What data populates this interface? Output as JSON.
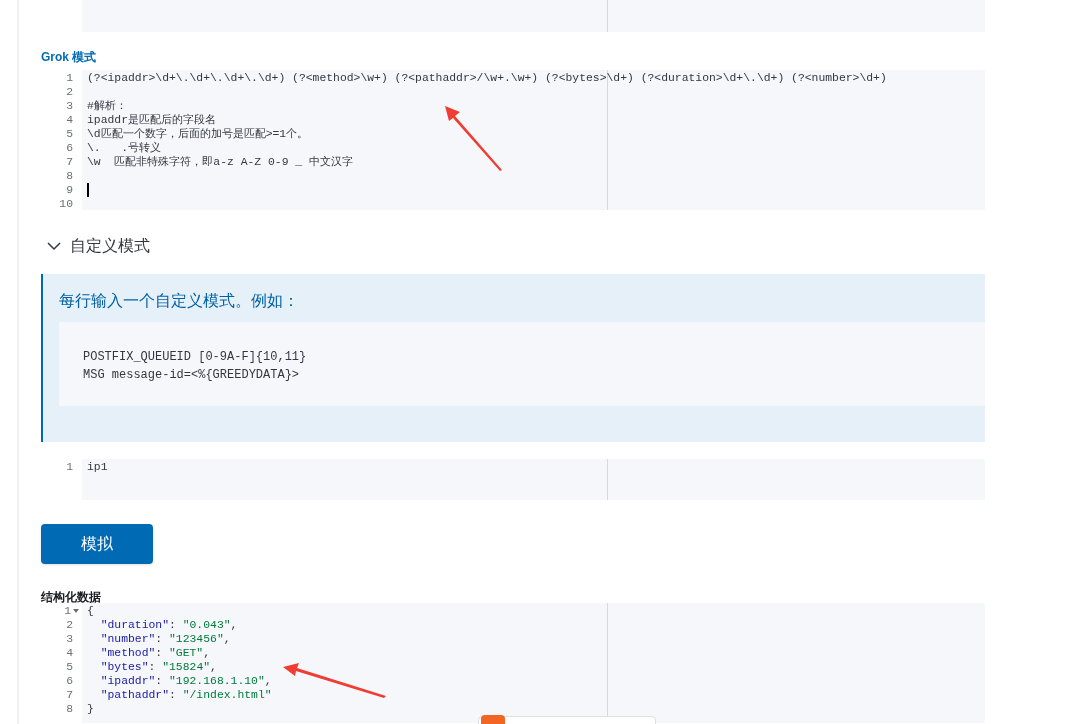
{
  "grok": {
    "label": "Grok 模式",
    "lines": [
      {
        "number": "1",
        "text": "(?<ipaddr>\\d+\\.\\d+\\.\\d+\\.\\d+) (?<method>\\w+) (?<pathaddr>/\\w+.\\w+) (?<bytes>\\d+) (?<duration>\\d+\\.\\d+) (?<number>\\d+)",
        "cursor": false
      },
      {
        "number": "2",
        "cursor": false
      },
      {
        "number": "3",
        "text": "#解析：",
        "cursor": false
      },
      {
        "number": "4",
        "text": "ipaddr是匹配后的字段名",
        "cursor": false
      },
      {
        "number": "5",
        "text": "\\d匹配一个数字，后面的加号是匹配>=1个。",
        "cursor": false
      },
      {
        "number": "6",
        "text": "\\.   .号转义",
        "cursor": false
      },
      {
        "number": "7",
        "text": "\\w  匹配非特殊字符，即a-z A-Z 0-9 _ 中文汉字",
        "cursor": false
      },
      {
        "number": "8",
        "cursor": false
      },
      {
        "number": "9",
        "cursor": true
      },
      {
        "number": "10",
        "cursor": false
      }
    ]
  },
  "custom": {
    "title": "自定义模式",
    "expanded": true,
    "callout": {
      "title": "每行输入一个自定义模式。例如：",
      "code": [
        "POSTFIX_QUEUEID [0-9A-F]{10,11}",
        "MSG message-id=<%{GREEDYDATA}>"
      ]
    },
    "editor": {
      "lines": [
        {
          "number": "1",
          "text": "ip1",
          "cursor": false
        }
      ]
    }
  },
  "simulate_button": "模拟",
  "output": {
    "label": "结构化数据",
    "line_numbers": [
      "1",
      "2",
      "3",
      "4",
      "5",
      "6",
      "7",
      "8"
    ],
    "lines": [
      [
        {
          "kind": "punct",
          "text": "{"
        }
      ],
      [
        {
          "kind": "key",
          "text": "  \"duration\""
        },
        {
          "kind": "punct",
          "text": ": "
        },
        {
          "kind": "string",
          "text": "\"0.043\""
        },
        {
          "kind": "punct",
          "text": ","
        }
      ],
      [
        {
          "kind": "key",
          "text": "  \"number\""
        },
        {
          "kind": "punct",
          "text": ": "
        },
        {
          "kind": "string",
          "text": "\"123456\""
        },
        {
          "kind": "punct",
          "text": ","
        }
      ],
      [
        {
          "kind": "key",
          "text": "  \"method\""
        },
        {
          "kind": "punct",
          "text": ": "
        },
        {
          "kind": "string",
          "text": "\"GET\""
        },
        {
          "kind": "punct",
          "text": ","
        }
      ],
      [
        {
          "kind": "key",
          "text": "  \"bytes\""
        },
        {
          "kind": "punct",
          "text": ": "
        },
        {
          "kind": "string",
          "text": "\"15824\""
        },
        {
          "kind": "punct",
          "text": ","
        }
      ],
      [
        {
          "kind": "key",
          "text": "  \"ipaddr\""
        },
        {
          "kind": "punct",
          "text": ": "
        },
        {
          "kind": "string",
          "text": "\"192.168.1.10\""
        },
        {
          "kind": "punct",
          "text": ","
        }
      ],
      [
        {
          "kind": "key",
          "text": "  \"pathaddr\""
        },
        {
          "kind": "punct",
          "text": ": "
        },
        {
          "kind": "string",
          "text": "\"/index.html\""
        }
      ],
      [
        {
          "kind": "punct",
          "text": "}"
        }
      ]
    ],
    "folded": false
  }
}
